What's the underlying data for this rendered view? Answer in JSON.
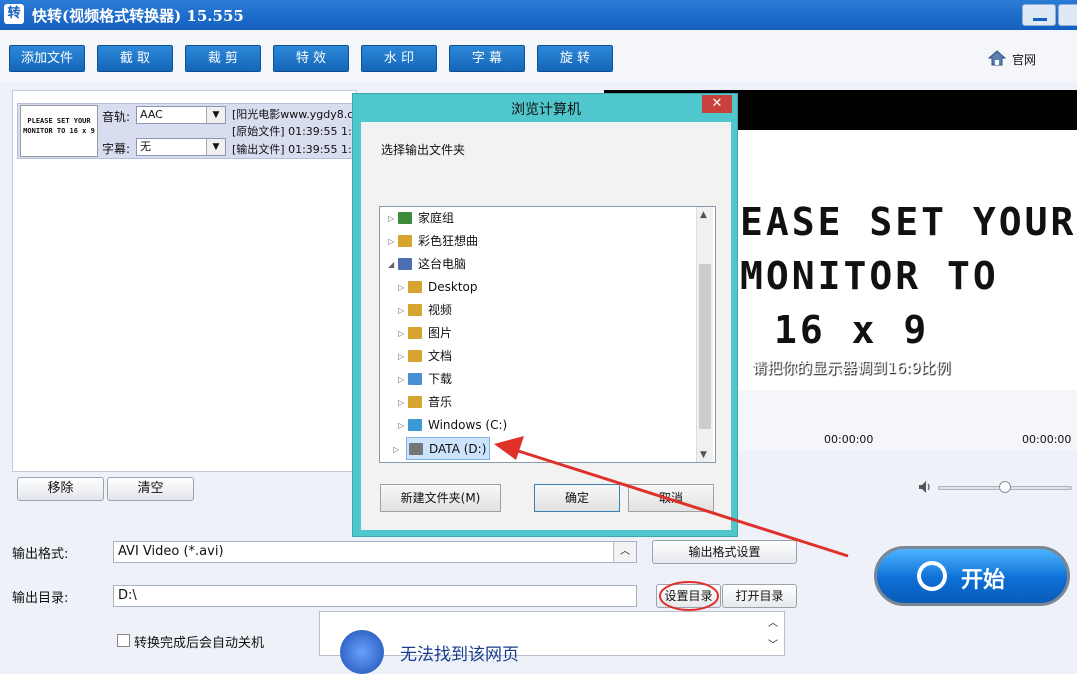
{
  "app": {
    "icon_glyph": "转",
    "title": "快转(视频格式转换器) 15.555"
  },
  "toolbar": {
    "buttons": [
      "添加文件",
      "截 取",
      "裁 剪",
      "特 效",
      "水 印",
      "字 幕",
      "旋 转"
    ],
    "home_label": "官网"
  },
  "file_item": {
    "thumb_text": "PLEASE SET YOUR MONITOR TO 16 x 9",
    "audio_label": "音轨:",
    "audio_value": "AAC",
    "subtitle_label": "字幕:",
    "subtitle_value": "无",
    "info_lines": [
      "[阳光电影www.ygdy8.co",
      "[原始文件]  01:39:55  1:",
      "[输出文件]  01:39:55  1:"
    ]
  },
  "list_buttons": {
    "remove": "移除",
    "clear": "清空"
  },
  "preview": {
    "lines": [
      "EASE SET YOUR",
      "MONITOR TO",
      "16 x 9"
    ],
    "subtitle_overlay": "请把你的显示器调到16:9比例",
    "time_start": "00:00:00",
    "time_end": "00:00:00",
    "volume_level": 0.5
  },
  "output": {
    "format_label": "输出格式:",
    "format_value": "AVI Video (*.avi)",
    "format_settings_button": "输出格式设置",
    "dir_label": "输出目录:",
    "dir_value": "D:\\",
    "set_dir_button": "设置目录",
    "open_dir_button": "打开目录",
    "auto_shutdown_label": "转换完成后会自动关机",
    "start_button": "开始"
  },
  "info_panel": {
    "text": "无法找到该网页"
  },
  "dialog": {
    "title": "浏览计算机",
    "close_glyph": "✕",
    "prompt": "选择输出文件夹",
    "tree": [
      {
        "label": "家庭组",
        "level": 0,
        "expanded": false
      },
      {
        "label": "彩色狂想曲",
        "level": 0,
        "expanded": false
      },
      {
        "label": "这台电脑",
        "level": 0,
        "expanded": true
      },
      {
        "label": "Desktop",
        "level": 1,
        "expanded": false
      },
      {
        "label": "视频",
        "level": 1,
        "expanded": false
      },
      {
        "label": "图片",
        "level": 1,
        "expanded": false
      },
      {
        "label": "文档",
        "level": 1,
        "expanded": false
      },
      {
        "label": "下载",
        "level": 1,
        "expanded": false
      },
      {
        "label": "音乐",
        "level": 1,
        "expanded": false
      },
      {
        "label": "Windows (C:)",
        "level": 1,
        "expanded": false
      },
      {
        "label": "DATA (D:)",
        "level": 1,
        "expanded": false,
        "selected": true
      }
    ],
    "new_folder_button": "新建文件夹(M)",
    "ok_button": "确定",
    "cancel_button": "取消"
  },
  "colors": {
    "accent": "#1567b8",
    "dialog_frame": "#4fc7cc",
    "annotation": "#e0302a"
  }
}
